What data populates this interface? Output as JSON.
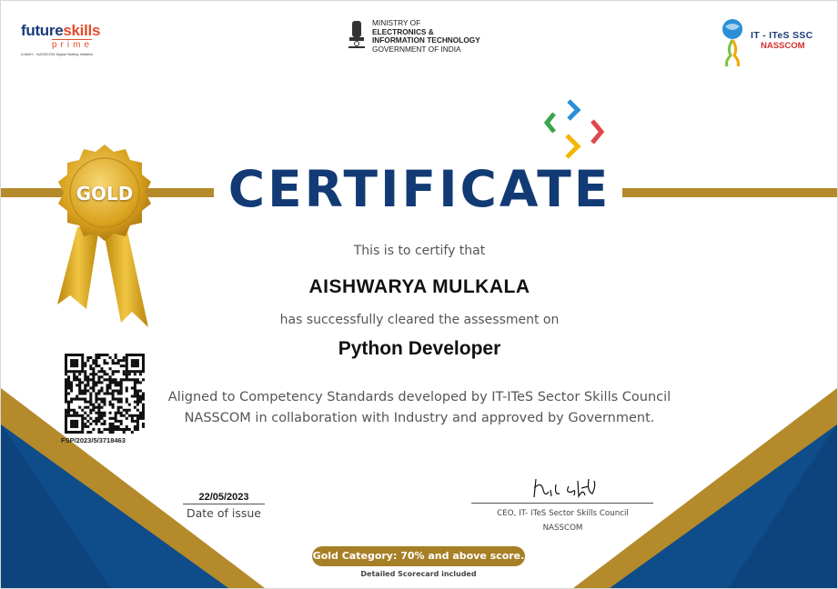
{
  "header": {
    "futureskills_logo": {
      "word_future": "future",
      "word_skills": "skills",
      "sub": "prime",
      "tagline": "A MeitY - NASSCOM Digital Skilling Initiative"
    },
    "ministry": {
      "line1": "MINISTRY OF",
      "line2": "ELECTRONICS &",
      "line3": "INFORMATION TECHNOLOGY",
      "line4": "GOVERNMENT OF INDIA",
      "hindi_caption": "सत्यमेव जयते"
    },
    "ssc_logo": {
      "line1": "IT - ITeS SSC",
      "line2": "NASSCOM"
    }
  },
  "badge": {
    "label": "GOLD"
  },
  "certificate": {
    "title": "CERTIFICATE",
    "certify_line": "This is to certify that",
    "recipient_name": "AISHWARYA MULKALA",
    "cleared_line": "has successfully cleared the assessment on",
    "course": "Python Developer",
    "aligned_line1": "Aligned to Competency Standards developed by IT-ITeS Sector Skills Council",
    "aligned_line2": "NASSCOM in collaboration with Industry and approved by Government."
  },
  "qr": {
    "id": "FSP/2023/5/3718463"
  },
  "issue": {
    "date": "22/05/2023",
    "label": "Date of issue"
  },
  "signatory": {
    "title": "CEO, IT- ITeS Sector Skills Council",
    "org": "NASSCOM"
  },
  "footer": {
    "category": "Gold Category: 70% and above score.",
    "note": "Detailed Scorecard included"
  },
  "colors": {
    "navy": "#123a75",
    "gold": "#b48a2b",
    "blue_corner": "#0f4c8a"
  },
  "icons": [
    "ashoka-emblem-icon",
    "globe-person-icon",
    "chevron-arrows-icon",
    "gold-seal-icon",
    "qr-code-icon"
  ]
}
